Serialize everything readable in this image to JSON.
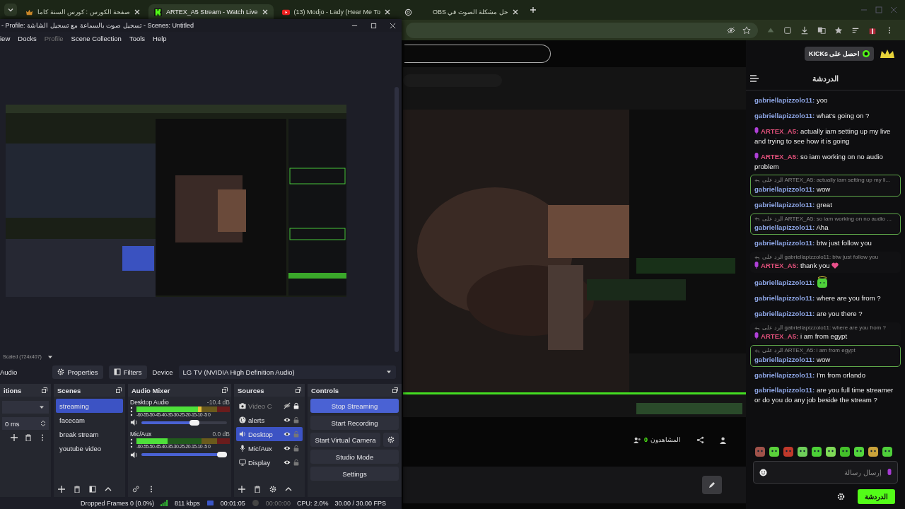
{
  "browser": {
    "tabs": [
      {
        "title": "صفحة الكورس : كورس السنة كاما",
        "kind": "course",
        "selected": false
      },
      {
        "title": "ARTEX_A5 Stream - Watch Live",
        "kind": "kick",
        "selected": true
      },
      {
        "title": "(13) Modjo - Lady (Hear Me To",
        "kind": "youtube",
        "selected": false
      },
      {
        "kind": "chatgpt",
        "selected": false
      },
      {
        "title": "حل مشكلة الصوت في OBS",
        "kind": "blank",
        "selected": false
      }
    ]
  },
  "obs": {
    "title": "- Profile: تسجيل صوت بالسماعة مع تسجيل الشاشة - Scenes: Untitled",
    "menu": [
      {
        "label": "iew",
        "disabled": false
      },
      {
        "label": "Docks",
        "disabled": false
      },
      {
        "label": "Profile",
        "disabled": true
      },
      {
        "label": "Scene Collection",
        "disabled": false
      },
      {
        "label": "Tools",
        "disabled": false
      },
      {
        "label": "Help",
        "disabled": false
      }
    ],
    "scale_label": "Scaled (724x407)",
    "toolbar": {
      "source_label": "Audio",
      "properties": "Properties",
      "filters": "Filters",
      "device_label": "Device",
      "device": "LG TV (NVIDIA High Definition Audio)"
    },
    "transitions": {
      "title": "itions",
      "duration": "0 ms"
    },
    "scenes": {
      "title": "Scenes",
      "items": [
        {
          "name": "streaming",
          "selected": true
        },
        {
          "name": "facecam",
          "selected": false
        },
        {
          "name": "break stream",
          "selected": false
        },
        {
          "name": "youtube video",
          "selected": false
        }
      ]
    },
    "mixer": {
      "title": "Audio Mixer",
      "channels": [
        {
          "name": "Desktop Audio",
          "reading": "-10.4 dB",
          "scale": "-60-55-50-45-40-35-30-25-20-15-10 -5 0",
          "meter": {
            "level": 0.7
          },
          "volume": {
            "level": 0.64
          }
        },
        {
          "name": "Mic/Aux",
          "reading": "0.0 dB",
          "scale": "-60-55-50-45-40-35-30-25-20-15-10 -5 0",
          "meter": {
            "level": 0.33
          },
          "volume": {
            "level": 1
          }
        }
      ]
    },
    "sources": {
      "title": "Sources",
      "items": [
        {
          "name": "Video C",
          "kind": "camera",
          "visible": false,
          "locked": true,
          "selected": false
        },
        {
          "name": "alerts",
          "kind": "globe",
          "visible": true,
          "locked": false,
          "selected": false
        },
        {
          "name": "Desktop",
          "kind": "speaker",
          "visible": true,
          "locked": false,
          "selected": true
        },
        {
          "name": "Mic/Aux",
          "kind": "mic",
          "visible": true,
          "locked": false,
          "selected": false
        },
        {
          "name": "Display",
          "kind": "monitor",
          "visible": true,
          "locked": false,
          "selected": false
        }
      ]
    },
    "controls": {
      "title": "Controls",
      "buttons": [
        {
          "label": "Stop Streaming",
          "active": true,
          "kind": "plain"
        },
        {
          "label": "Start Recording",
          "active": false,
          "kind": "plain"
        },
        {
          "label": "Start Virtual Camera",
          "active": false,
          "kind": "with_gear"
        },
        {
          "label": "Studio Mode",
          "active": false,
          "kind": "plain"
        },
        {
          "label": "Settings",
          "active": false,
          "kind": "plain"
        }
      ]
    },
    "status": {
      "dropped": "Dropped Frames 0 (0.0%)",
      "bitrate": "811 kbps",
      "stream_time": "00:01:05",
      "record_time": "00:00:00",
      "cpu": "CPU: 2.0%",
      "fps": "30.00 / 30.00 FPS"
    }
  },
  "page": {
    "viewers": {
      "count": "0",
      "label": "المشاهدون"
    }
  },
  "chat": {
    "kicks_button": "احصل على KICKs",
    "title": "الدردشة",
    "messages": [
      {
        "user": "gabriellapizzolo11:",
        "color": "#8ea6e6",
        "badge": false,
        "text": "yoo"
      },
      {
        "user": "gabriellapizzolo11:",
        "color": "#8ea6e6",
        "badge": false,
        "text": "what's going on ?"
      },
      {
        "user": "ARTEX_A5:",
        "color": "#e0507a",
        "badge": true,
        "text": "actually iam setting up my live and trying to see how it is going"
      },
      {
        "user": "ARTEX_A5:",
        "color": "#e0507a",
        "badge": true,
        "text": "so iam working on no audio problem"
      },
      {
        "user": "gabriellapizzolo11:",
        "color": "#8ea6e6",
        "badge": false,
        "text": "wow",
        "reply_to": "الرد على ARTEX_A5: actually iam setting up my li...",
        "highlighted": true
      },
      {
        "user": "gabriellapizzolo11:",
        "color": "#8ea6e6",
        "badge": false,
        "text": "great"
      },
      {
        "user": "gabriellapizzolo11:",
        "color": "#8ea6e6",
        "badge": false,
        "text": "Aha",
        "reply_to": "الرد على ARTEX_A5: so iam working on no audio ...",
        "highlighted": true
      },
      {
        "user": "gabriellapizzolo11:",
        "color": "#8ea6e6",
        "badge": false,
        "text": "btw just follow you"
      },
      {
        "user": "ARTEX_A5:",
        "color": "#e0507a",
        "badge": true,
        "text": "thank you",
        "kind": "heart",
        "reply_to": "الرد على gabriellapizzolo11: btw just follow you",
        "highlighted": false
      },
      {
        "user": "gabriellapizzolo11:",
        "color": "#8ea6e6",
        "badge": false,
        "kind": "emote"
      },
      {
        "user": "gabriellapizzolo11:",
        "color": "#8ea6e6",
        "badge": false,
        "text": "where are you from ?"
      },
      {
        "user": "gabriellapizzolo11:",
        "color": "#8ea6e6",
        "badge": false,
        "text": "are you there ?"
      },
      {
        "user": "ARTEX_A5:",
        "color": "#e0507a",
        "badge": true,
        "text": "i am from egypt",
        "reply_to": "الرد على gabriellapizzolo11: where are you from ?",
        "highlighted": false
      },
      {
        "user": "gabriellapizzolo11:",
        "color": "#8ea6e6",
        "badge": false,
        "text": "wow",
        "reply_to": "الرد على ARTEX_A5: i am from egypt",
        "highlighted": true
      },
      {
        "user": "gabriellapizzolo11:",
        "color": "#8ea6e6",
        "badge": false,
        "text": "I'm from orlando"
      },
      {
        "user": "gabriellapizzolo11:",
        "color": "#8ea6e6",
        "badge": false,
        "text": "are you full time streamer or do you do any job beside the stream ?"
      }
    ],
    "input_placeholder": "إرسال رسالة",
    "send_button": "الدردشة"
  }
}
